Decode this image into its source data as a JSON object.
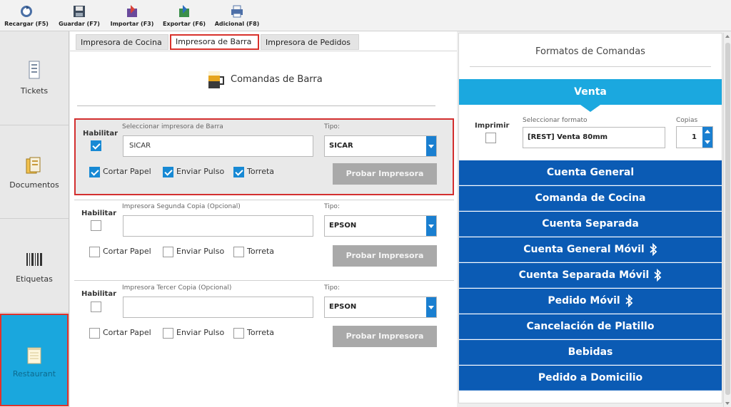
{
  "toolbar": {
    "items": [
      {
        "label": "Recargar (F5)",
        "icon": "reload-icon"
      },
      {
        "label": "Guardar (F7)",
        "icon": "save-icon"
      },
      {
        "label": "Importar (F3)",
        "icon": "import-icon"
      },
      {
        "label": "Exportar (F6)",
        "icon": "export-icon"
      },
      {
        "label": "Adicional (F8)",
        "icon": "printer-icon"
      }
    ]
  },
  "sidebar": {
    "items": [
      {
        "label": "Tickets",
        "icon": "ticket-icon"
      },
      {
        "label": "Documentos",
        "icon": "documents-icon"
      },
      {
        "label": "Etiquetas",
        "icon": "barcode-icon"
      },
      {
        "label": "Restaurant",
        "icon": "notepad-icon",
        "active": true
      }
    ]
  },
  "tabs": [
    {
      "label": "Impresora de Cocina"
    },
    {
      "label": "Impresora de Barra",
      "active": true
    },
    {
      "label": "Impresora de Pedidos"
    }
  ],
  "section_title": "Comandas de Barra",
  "printers": [
    {
      "enable_label": "Habilitar",
      "enabled": true,
      "field_label": "Seleccionar impresora de Barra",
      "value": "SICAR",
      "type_label": "Tipo:",
      "type_value": "SICAR",
      "options": [
        {
          "label": "Cortar Papel",
          "checked": true
        },
        {
          "label": "Enviar Pulso",
          "checked": true
        },
        {
          "label": "Torreta",
          "checked": true
        }
      ],
      "test_button": "Probar Impresora"
    },
    {
      "enable_label": "Habilitar",
      "enabled": false,
      "field_label": "Impresora Segunda Copia (Opcional)",
      "value": "",
      "type_label": "Tipo:",
      "type_value": "EPSON",
      "options": [
        {
          "label": "Cortar Papel",
          "checked": false
        },
        {
          "label": "Enviar Pulso",
          "checked": false
        },
        {
          "label": "Torreta",
          "checked": false
        }
      ],
      "test_button": "Probar Impresora"
    },
    {
      "enable_label": "Habilitar",
      "enabled": false,
      "field_label": "Impresora Tercer Copia (Opcional)",
      "value": "",
      "type_label": "Tipo:",
      "type_value": "EPSON",
      "options": [
        {
          "label": "Cortar Papel",
          "checked": false
        },
        {
          "label": "Enviar Pulso",
          "checked": false
        },
        {
          "label": "Torreta",
          "checked": false
        }
      ],
      "test_button": "Probar Impresora"
    }
  ],
  "formats": {
    "title": "Formatos de Comandas",
    "active_format": "Venta",
    "print_label": "Imprimir",
    "print_checked": false,
    "select_label": "Seleccionar formato",
    "select_value": "[REST] Venta 80mm",
    "copies_label": "Copias",
    "copies_value": "1",
    "list": [
      {
        "label": "Cuenta General",
        "bluetooth": false
      },
      {
        "label": "Comanda de Cocina",
        "bluetooth": false
      },
      {
        "label": "Cuenta Separada",
        "bluetooth": false
      },
      {
        "label": "Cuenta General Móvil",
        "bluetooth": true
      },
      {
        "label": "Cuenta Separada Móvil",
        "bluetooth": true
      },
      {
        "label": "Pedido Móvil",
        "bluetooth": true
      },
      {
        "label": "Cancelación de Platillo",
        "bluetooth": false
      },
      {
        "label": "Bebidas",
        "bluetooth": false
      },
      {
        "label": "Pedido a Domicilio",
        "bluetooth": false
      }
    ]
  },
  "colors": {
    "accent": "#1ba8df",
    "format_button": "#0b5bb4",
    "highlight_border": "#d32f2f",
    "checkbox": "#1789d4"
  }
}
